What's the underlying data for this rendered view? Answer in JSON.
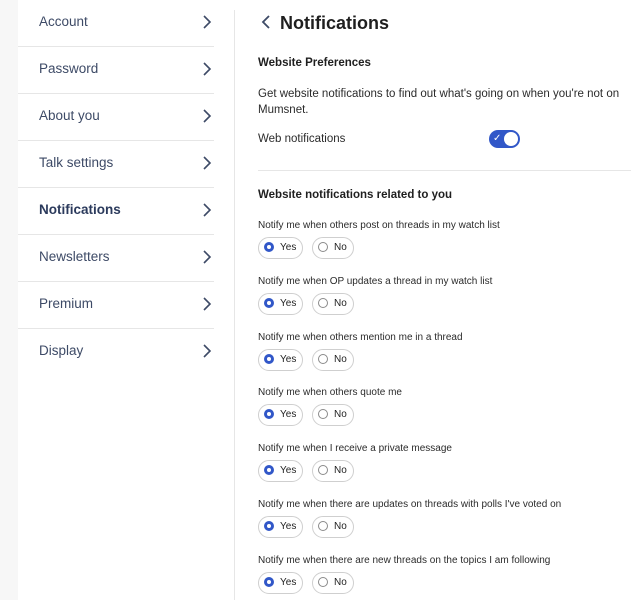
{
  "sidebar": {
    "items": [
      {
        "label": "Account",
        "active": false
      },
      {
        "label": "Password",
        "active": false
      },
      {
        "label": "About you",
        "active": false
      },
      {
        "label": "Talk settings",
        "active": false
      },
      {
        "label": "Notifications",
        "active": true
      },
      {
        "label": "Newsletters",
        "active": false
      },
      {
        "label": "Premium",
        "active": false
      },
      {
        "label": "Display",
        "active": false
      }
    ]
  },
  "header": {
    "title": "Notifications",
    "back_icon": "chevron-left-icon"
  },
  "preferences": {
    "heading": "Website Preferences",
    "description": "Get website notifications to find out what's going on when you're not on Mumsnet.",
    "web_notifications_label": "Web notifications",
    "web_notifications_enabled": true
  },
  "related": {
    "heading": "Website notifications related to you",
    "yes_label": "Yes",
    "no_label": "No",
    "questions": [
      {
        "label": "Notify me when others post on threads in my watch list",
        "value": "Yes"
      },
      {
        "label": "Notify me when OP updates a thread in my watch list",
        "value": "Yes"
      },
      {
        "label": "Notify me when others mention me in a thread",
        "value": "Yes"
      },
      {
        "label": "Notify me when others quote me",
        "value": "Yes"
      },
      {
        "label": "Notify me when I receive a private message",
        "value": "Yes"
      },
      {
        "label": "Notify me when there are updates on threads with polls I've voted on",
        "value": "Yes"
      },
      {
        "label": "Notify me when there are new threads on the topics I am following",
        "value": "Yes"
      }
    ]
  },
  "colors": {
    "accent": "#3157c8",
    "nav_text": "#3d4a66"
  }
}
